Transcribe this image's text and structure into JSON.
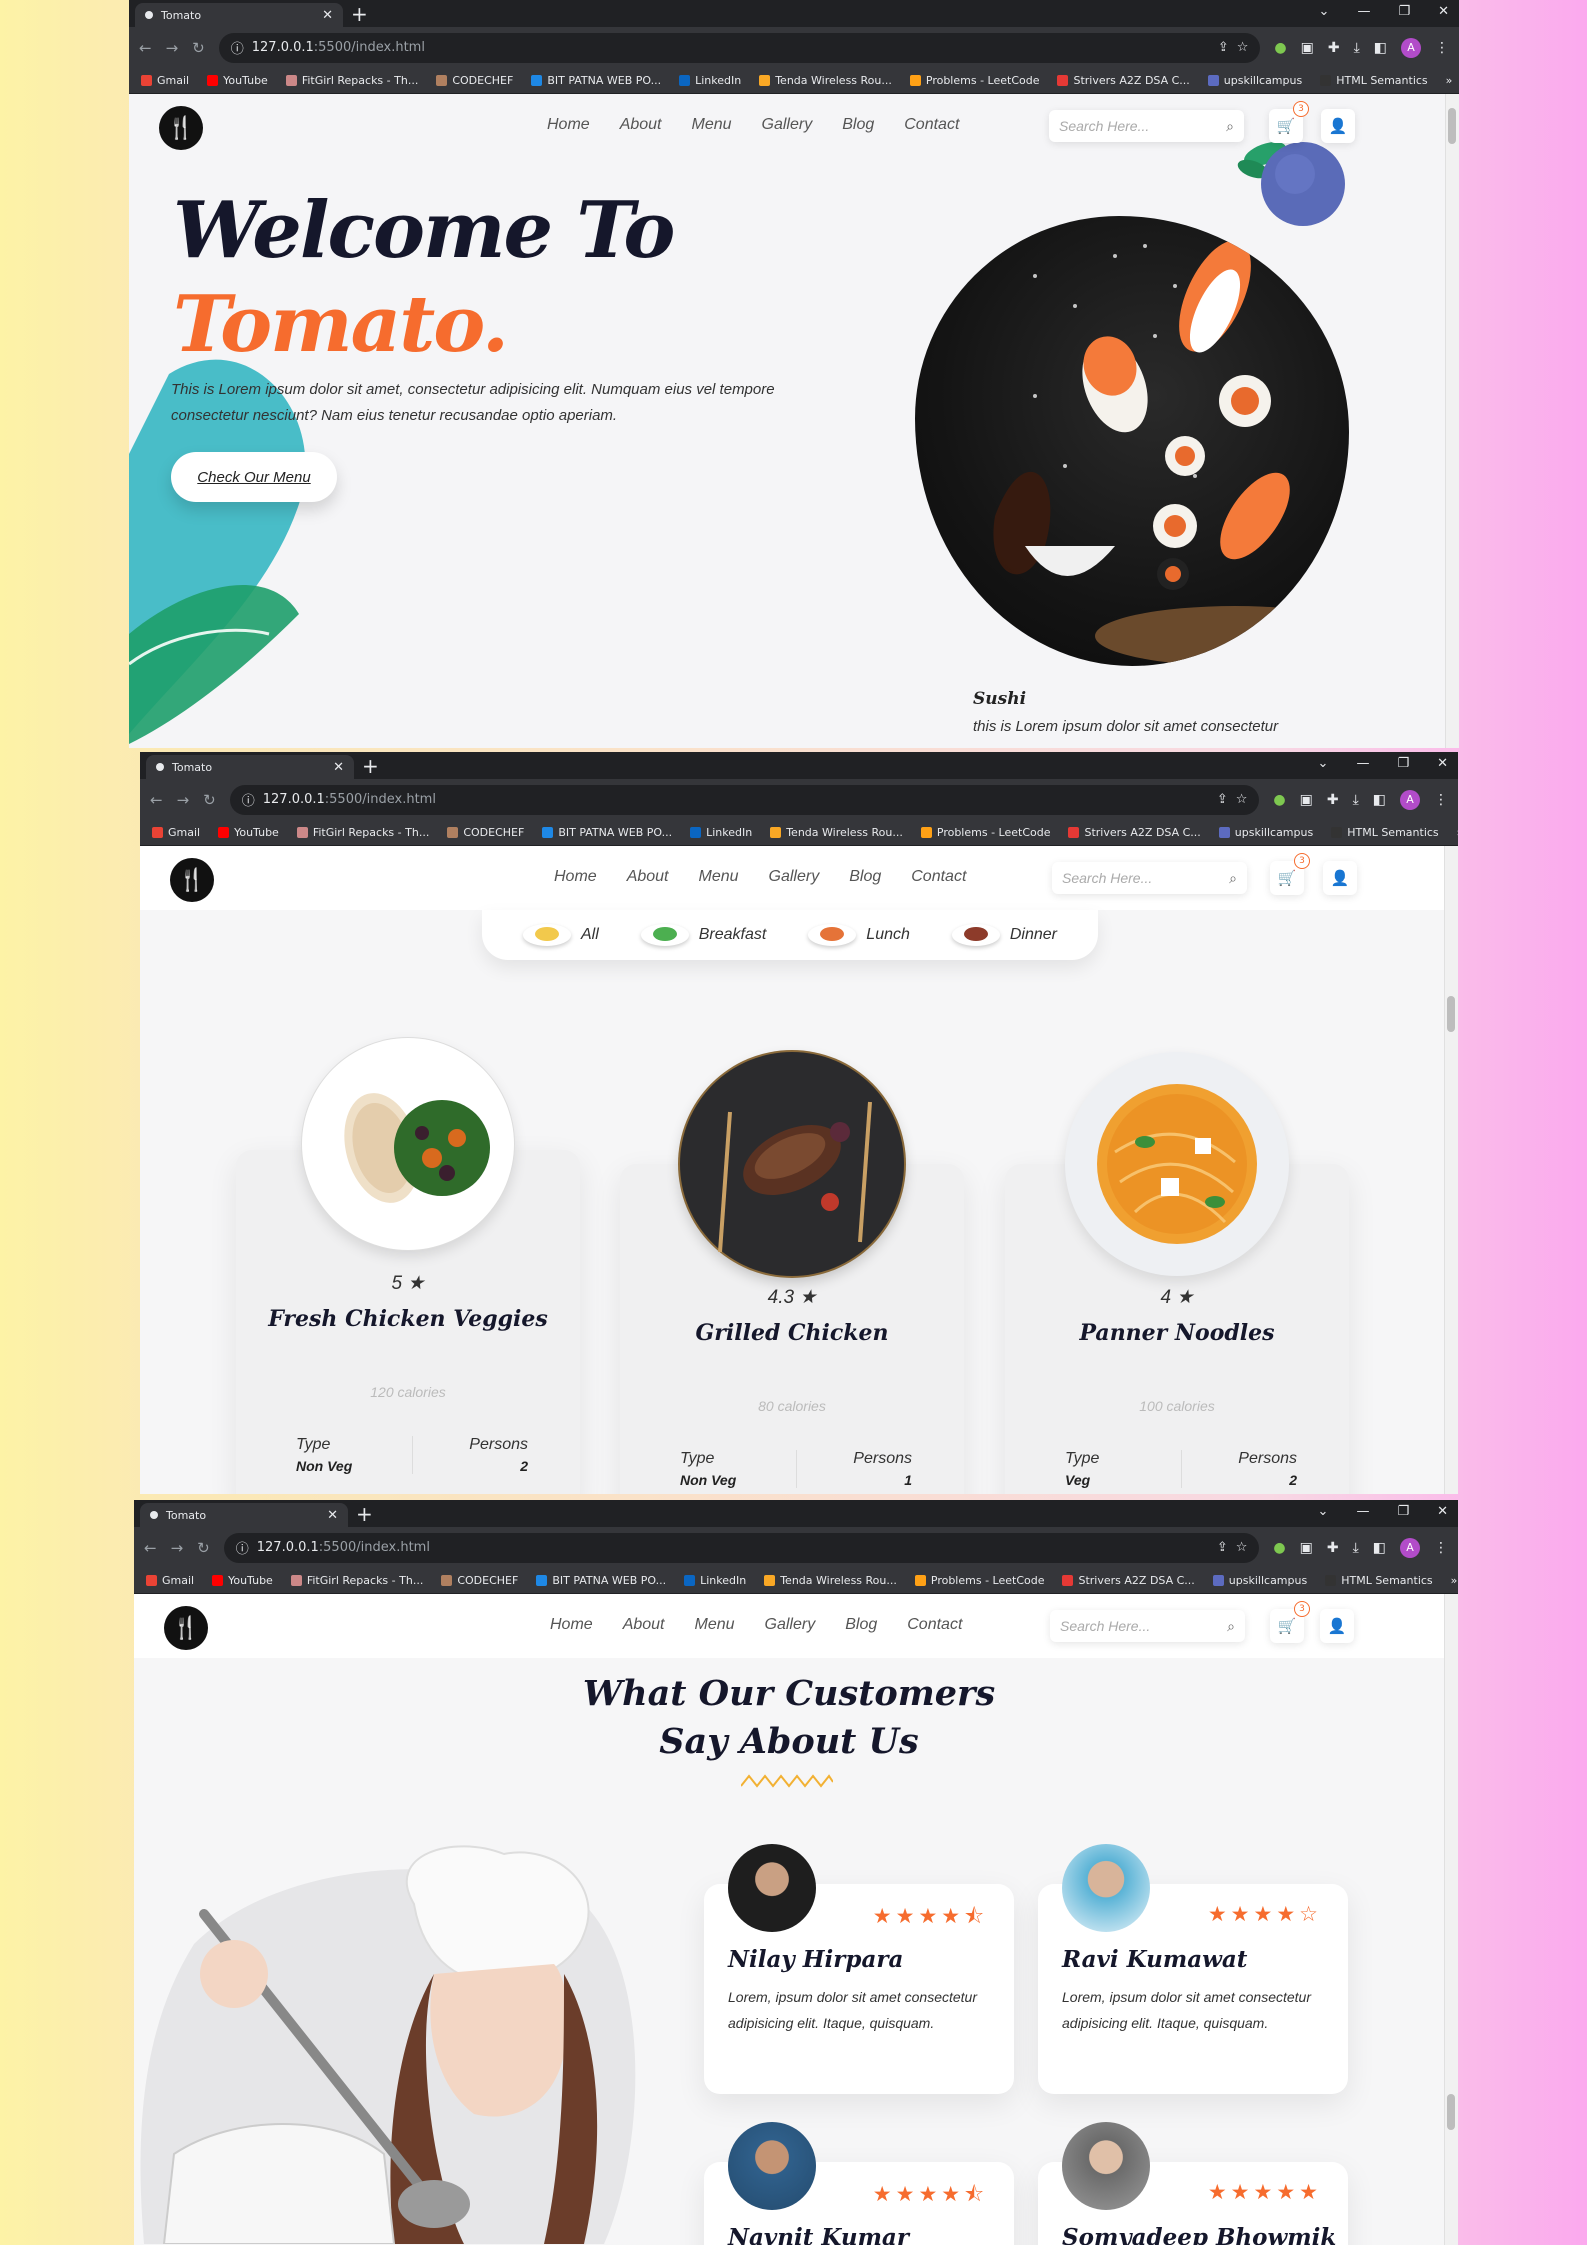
{
  "browser": {
    "tab_title": "Tomato",
    "url_host": "127.0.0.1",
    "url_rest": ":5500/index.html",
    "bookmarks": [
      "Gmail",
      "YouTube",
      "FitGirl Repacks - Th...",
      "CODECHEF",
      "BIT PATNA WEB PO...",
      "LinkedIn",
      "Tenda Wireless Rou...",
      "Problems - LeetCode",
      "Strivers A2Z DSA C...",
      "upskillcampus",
      "HTML Semantics"
    ],
    "profile_initial": "A"
  },
  "nav": {
    "items": [
      "Home",
      "About",
      "Menu",
      "Gallery",
      "Blog",
      "Contact"
    ],
    "search_placeholder": "Search Here...",
    "cart_count": "3"
  },
  "hero": {
    "title_line1": "Welcome To",
    "title_line2": "Tomato.",
    "paragraph": "This is Lorem ipsum dolor sit amet, consectetur adipisicing elit. Numquam eius vel tempore consectetur nesciunt? Nam eius tenetur recusandae optio aperiam.",
    "button": "Check Our Menu",
    "caption_title": "Sushi",
    "caption_text": "this is Lorem ipsum dolor sit amet consectetur"
  },
  "menu_section": {
    "filters": [
      "All",
      "Breakfast",
      "Lunch",
      "Dinner"
    ],
    "dishes": [
      {
        "rating": "5",
        "name": "Fresh Chicken Veggies",
        "calories": "120 calories",
        "type_label": "Type",
        "type": "Non Veg",
        "persons_label": "Persons",
        "persons": "2"
      },
      {
        "rating": "4.3",
        "name": "Grilled Chicken",
        "calories": "80 calories",
        "type_label": "Type",
        "type": "Non Veg",
        "persons_label": "Persons",
        "persons": "1"
      },
      {
        "rating": "4",
        "name": "Panner Noodles",
        "calories": "100 calories",
        "type_label": "Type",
        "type": "Veg",
        "persons_label": "Persons",
        "persons": "2"
      }
    ]
  },
  "testimonials": {
    "title_line1": "What Our Customers",
    "title_line2": "Say About Us",
    "reviews": [
      {
        "name": "Nilay Hirpara",
        "stars": 4.5,
        "text": "Lorem, ipsum dolor sit amet consectetur adipisicing elit. Itaque, quisquam."
      },
      {
        "name": "Ravi Kumawat",
        "stars": 4,
        "text": "Lorem, ipsum dolor sit amet consectetur adipisicing elit. Itaque, quisquam."
      },
      {
        "name": "Navnit Kumar",
        "stars": 4.5,
        "text": ""
      },
      {
        "name": "Somyadeep Bhowmik",
        "stars": 5,
        "text": ""
      }
    ]
  },
  "colors": {
    "accent": "#f66c2e",
    "dark": "#15172b"
  }
}
